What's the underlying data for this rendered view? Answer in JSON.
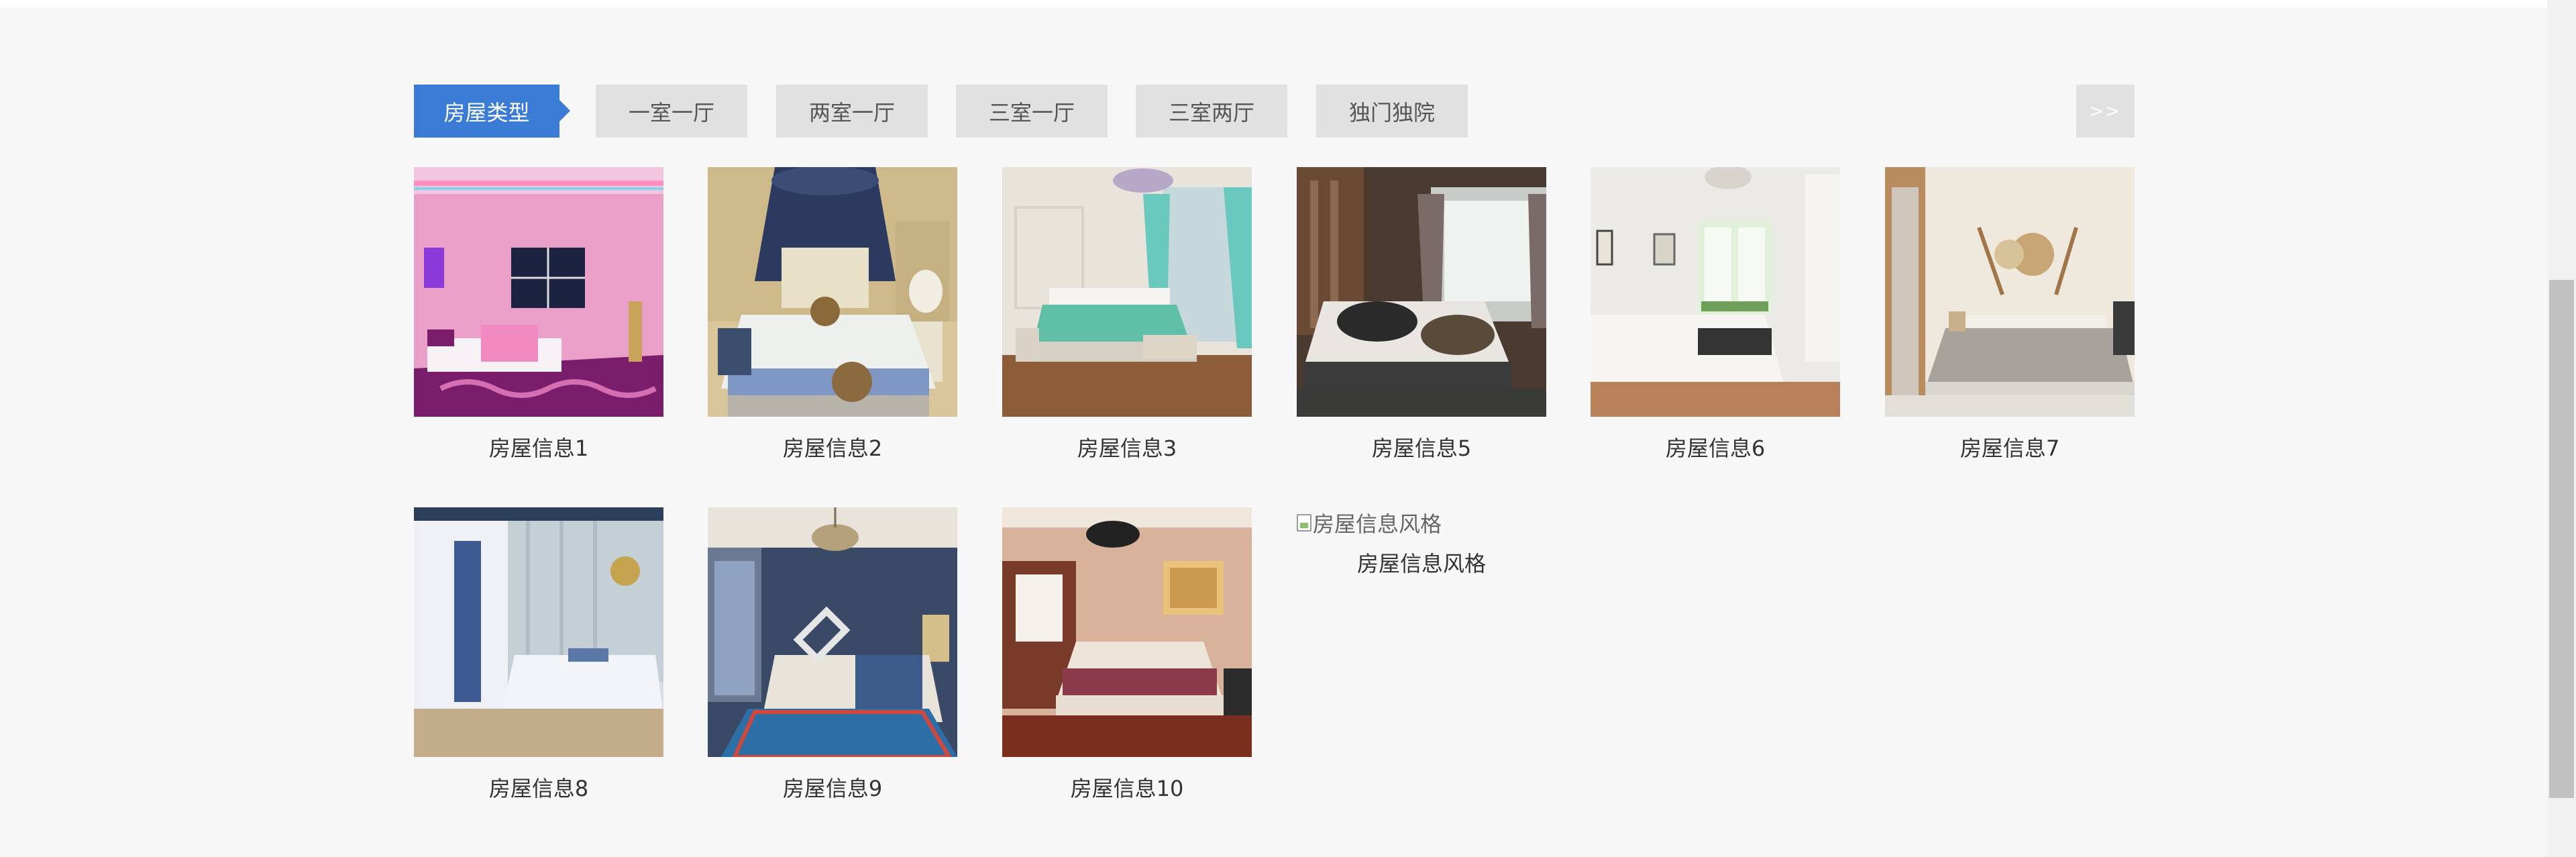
{
  "filter": {
    "active_label": "房屋类型",
    "types": [
      "一室一厅",
      "两室一厅",
      "三室一厅",
      "三室两厅",
      "独门独院"
    ],
    "more_label": ">>"
  },
  "listings": [
    {
      "caption": "房屋信息1"
    },
    {
      "caption": "房屋信息2"
    },
    {
      "caption": "房屋信息3"
    },
    {
      "caption": "房屋信息5"
    },
    {
      "caption": "房屋信息6"
    },
    {
      "caption": "房屋信息7"
    },
    {
      "caption": "房屋信息8"
    },
    {
      "caption": "房屋信息9"
    },
    {
      "caption": "房屋信息10"
    }
  ],
  "broken_listing": {
    "alt_text": "房屋信息风格",
    "caption": "房屋信息风格"
  },
  "colors": {
    "accent": "#3a7bd5",
    "tab_bg": "#e1e1e1",
    "page_bg": "#f7f7f7"
  }
}
